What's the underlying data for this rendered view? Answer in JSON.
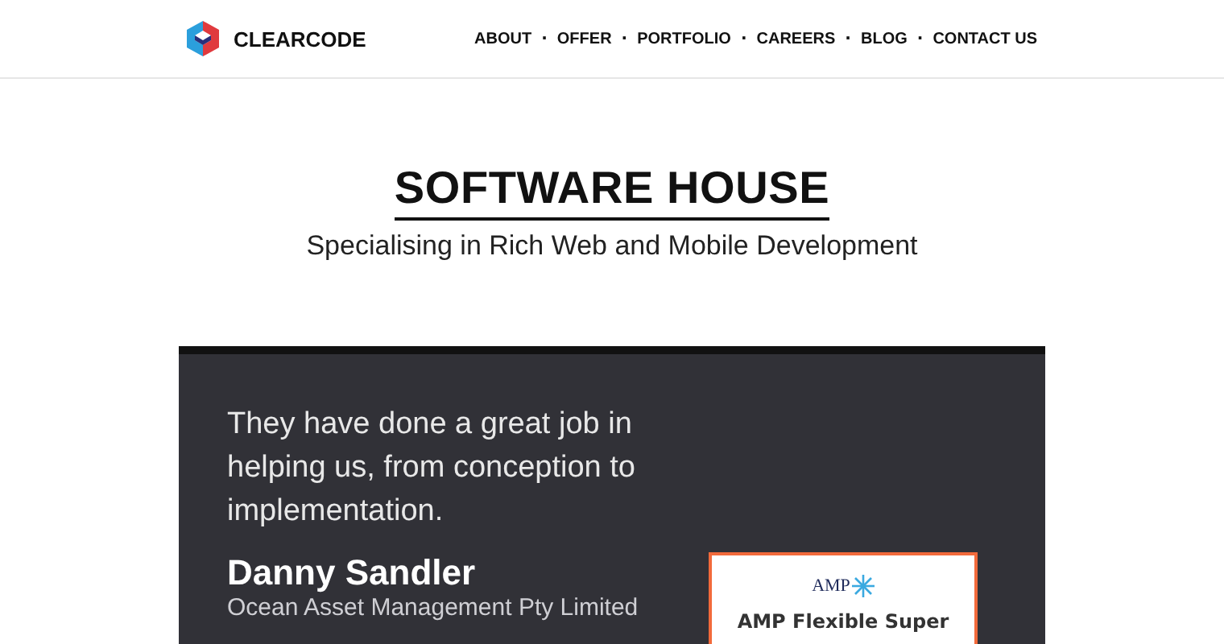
{
  "header": {
    "brand": "CLEARCODE",
    "nav": [
      "ABOUT",
      "OFFER",
      "PORTFOLIO",
      "CAREERS",
      "BLOG",
      "CONTACT US"
    ],
    "separator": "·"
  },
  "hero": {
    "title": "SOFTWARE HOUSE",
    "subtitle": "Specialising in Rich Web and Mobile Development"
  },
  "testimonial": {
    "quote": "They have done a great job in helping us, from conception to implementation.",
    "name": "Danny Sandler",
    "company": "Ocean Asset Management Pty Limited",
    "card": {
      "logo": "AMP",
      "title": "AMP Flexible Super"
    }
  }
}
